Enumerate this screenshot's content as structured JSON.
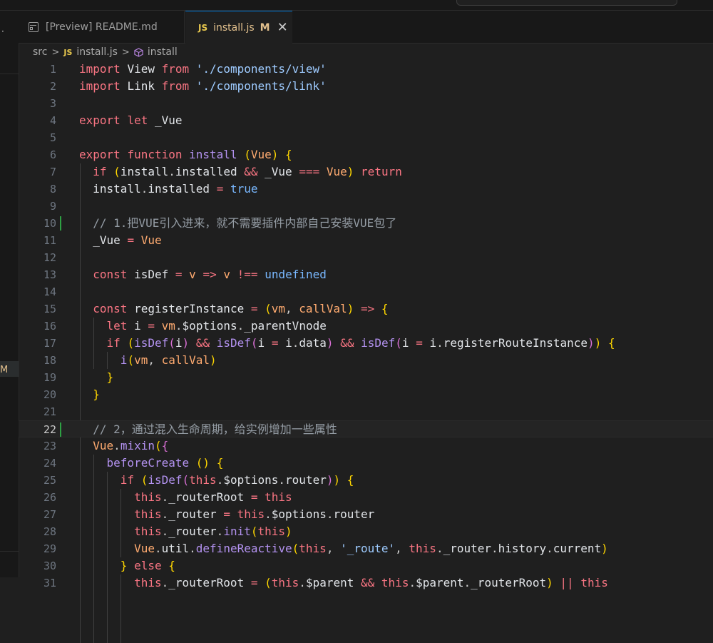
{
  "tabs": [
    {
      "label": "[Preview] README.md",
      "icon": "preview-icon"
    },
    {
      "label": "install.js",
      "icon": "js-icon",
      "modified": "M",
      "close": "✕"
    }
  ],
  "breadcrumbs": {
    "folder": "src",
    "file": "install.js",
    "symbol": "install",
    "js_badge": "JS"
  },
  "activity": {
    "modified_flag": "M"
  },
  "editor": {
    "current_line": 22,
    "lines": [
      {
        "n": "1"
      },
      {
        "n": "2"
      },
      {
        "n": "3"
      },
      {
        "n": "4"
      },
      {
        "n": "5"
      },
      {
        "n": "6"
      },
      {
        "n": "7"
      },
      {
        "n": "8"
      },
      {
        "n": "9"
      },
      {
        "n": "10"
      },
      {
        "n": "11"
      },
      {
        "n": "12"
      },
      {
        "n": "13"
      },
      {
        "n": "14"
      },
      {
        "n": "15"
      },
      {
        "n": "16"
      },
      {
        "n": "17"
      },
      {
        "n": "18"
      },
      {
        "n": "19"
      },
      {
        "n": "20"
      },
      {
        "n": "21"
      },
      {
        "n": "22"
      },
      {
        "n": "23"
      },
      {
        "n": "24"
      },
      {
        "n": "25"
      },
      {
        "n": "26"
      },
      {
        "n": "27"
      },
      {
        "n": "28"
      },
      {
        "n": "29"
      },
      {
        "n": "30"
      },
      {
        "n": "31"
      }
    ],
    "code": [
      "import View from './components/view'",
      "import Link from './components/link'",
      "",
      "export let _Vue",
      "",
      "export function install (Vue) {",
      "  if (install.installed && _Vue === Vue) return",
      "  install.installed = true",
      "",
      "  // 1.把VUE引入进来，就不需要插件内部自己安装VUE包了",
      "  _Vue = Vue",
      "",
      "  const isDef = v => v !== undefined",
      "",
      "  const registerInstance = (vm, callVal) => {",
      "    let i = vm.$options._parentVnode",
      "    if (isDef(i) && isDef(i = i.data) && isDef(i = i.registerRouteInstance)) {",
      "      i(vm, callVal)",
      "    }",
      "  }",
      "",
      "  // 2，通过混入生命周期，给实例增加一些属性",
      "  Vue.mixin({",
      "    beforeCreate () {",
      "      if (isDef(this.$options.router)) {",
      "        this._routerRoot = this",
      "        this._router = this.$options.router",
      "        this._router.init(this)",
      "        Vue.util.defineReactive(this, '_route', this._router.history.current)",
      "      } else {",
      "        this._routerRoot = (this.$parent && this.$parent._routerRoot) || this"
    ]
  }
}
